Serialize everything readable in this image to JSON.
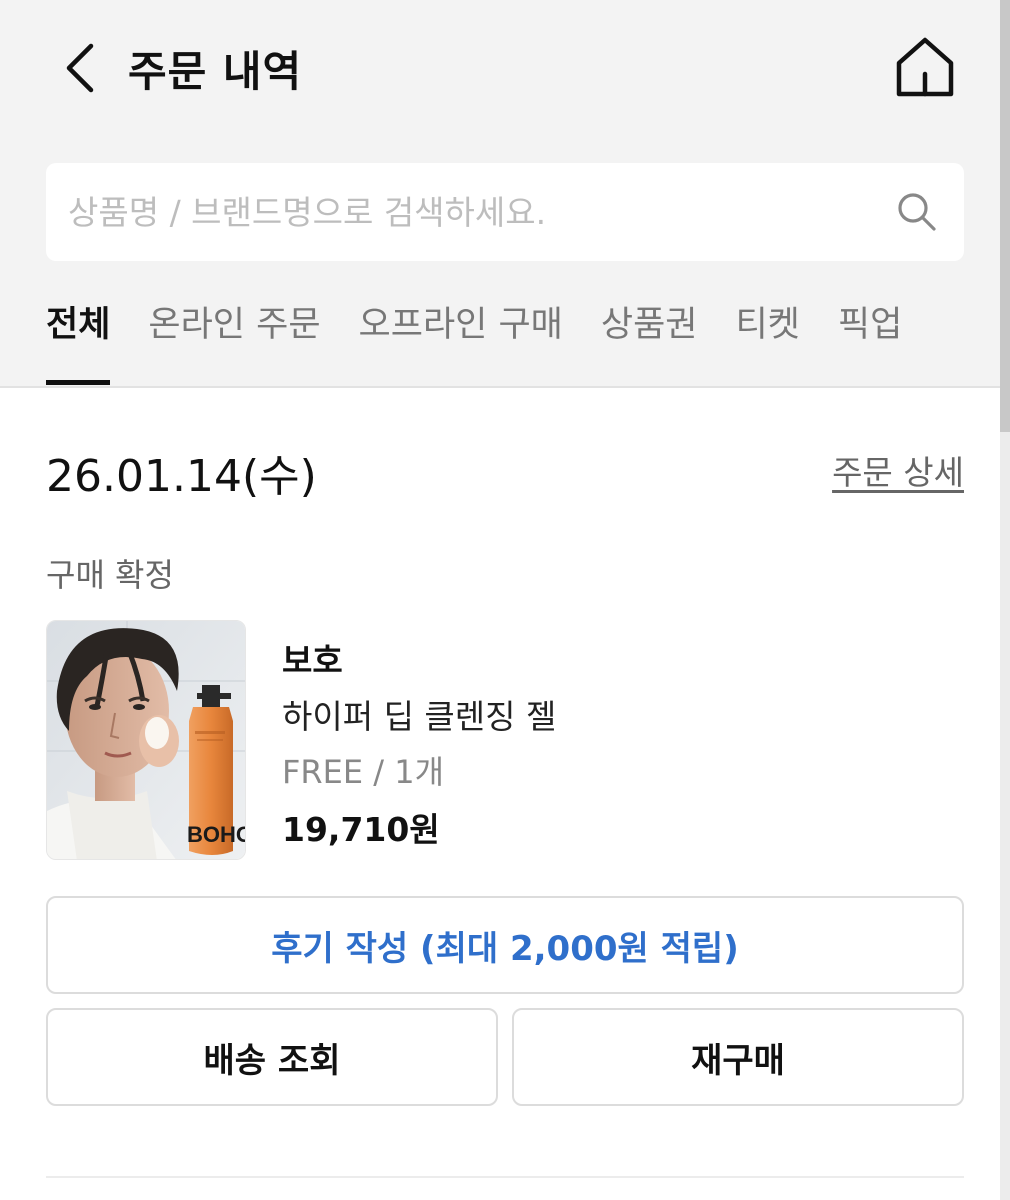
{
  "header": {
    "title": "주문 내역",
    "back_icon": "chevron-left-icon",
    "home_icon": "home-icon"
  },
  "search": {
    "placeholder": "상품명 / 브랜드명으로 검색하세요.",
    "value": "",
    "icon": "search-icon"
  },
  "tabs": [
    {
      "label": "전체",
      "active": true
    },
    {
      "label": "온라인 주문",
      "active": false
    },
    {
      "label": "오프라인 구매",
      "active": false
    },
    {
      "label": "상품권",
      "active": false
    },
    {
      "label": "티켓",
      "active": false
    },
    {
      "label": "픽업",
      "active": false
    }
  ],
  "order": {
    "date": "26.01.14(수)",
    "detail_link": "주문 상세",
    "status": "구매 확정",
    "item": {
      "brand": "보호",
      "name": "하이퍼 딥 클렌징 젤",
      "option": "FREE / 1개",
      "price": "19,710원",
      "image_logo_text": "BOHO"
    },
    "buttons": {
      "review": "후기 작성 (최대 2,000원 적립)",
      "delivery": "배송 조회",
      "rebuy": "재구매"
    }
  },
  "colors": {
    "top_background": "#f3f3f3",
    "accent_blue": "#2f6fcb",
    "bottle_orange": "#e8863c"
  }
}
